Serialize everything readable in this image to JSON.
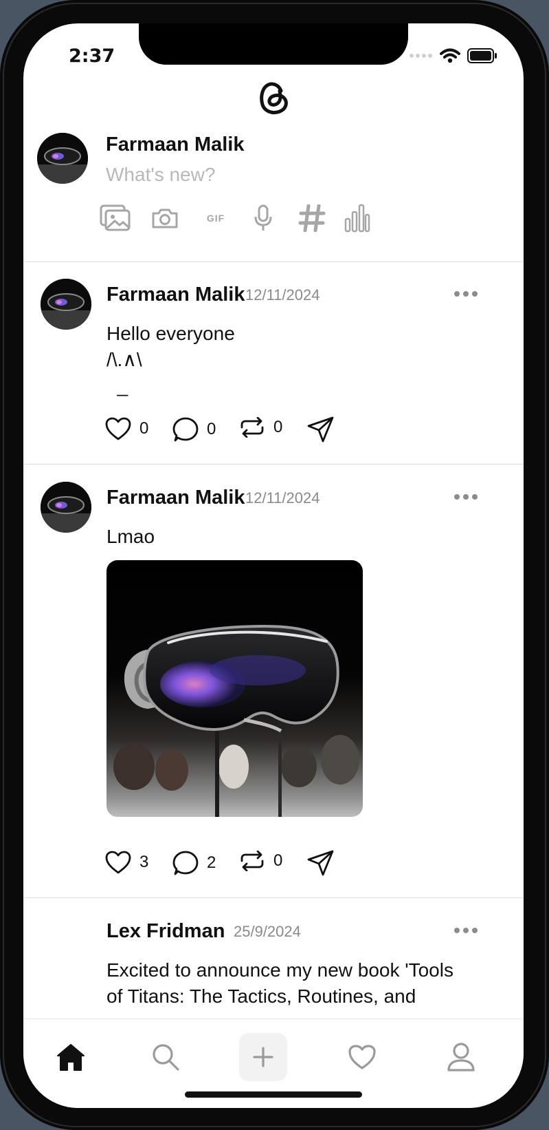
{
  "status_bar": {
    "time": "2:37"
  },
  "composer": {
    "user_name": "Farmaan Malik",
    "placeholder": "What's new?",
    "tools": [
      "photo-library-icon",
      "camera-icon",
      "gif-icon",
      "microphone-icon",
      "hashtag-icon",
      "poll-icon"
    ],
    "gif_label": "GIF"
  },
  "posts": [
    {
      "author": "Farmaan Malik",
      "date": "12/11/2024",
      "text": "Hello everyone\n/\\.∧\\\n  _",
      "likes": "0",
      "comments": "0",
      "reposts": "0"
    },
    {
      "author": "Farmaan Malik",
      "date": "12/11/2024",
      "text": "Lmao",
      "image": "vision-pro-headset-photo",
      "likes": "3",
      "comments": "2",
      "reposts": "0"
    },
    {
      "author": "Lex Fridman",
      "date": "25/9/2024",
      "text": "Excited to announce my new book 'Tools\nof Titans: The Tactics, Routines, and"
    }
  ],
  "tab_bar": {
    "items": [
      "home-icon",
      "search-icon",
      "compose-icon",
      "activity-heart-icon",
      "profile-icon"
    ],
    "active": "home-icon"
  }
}
